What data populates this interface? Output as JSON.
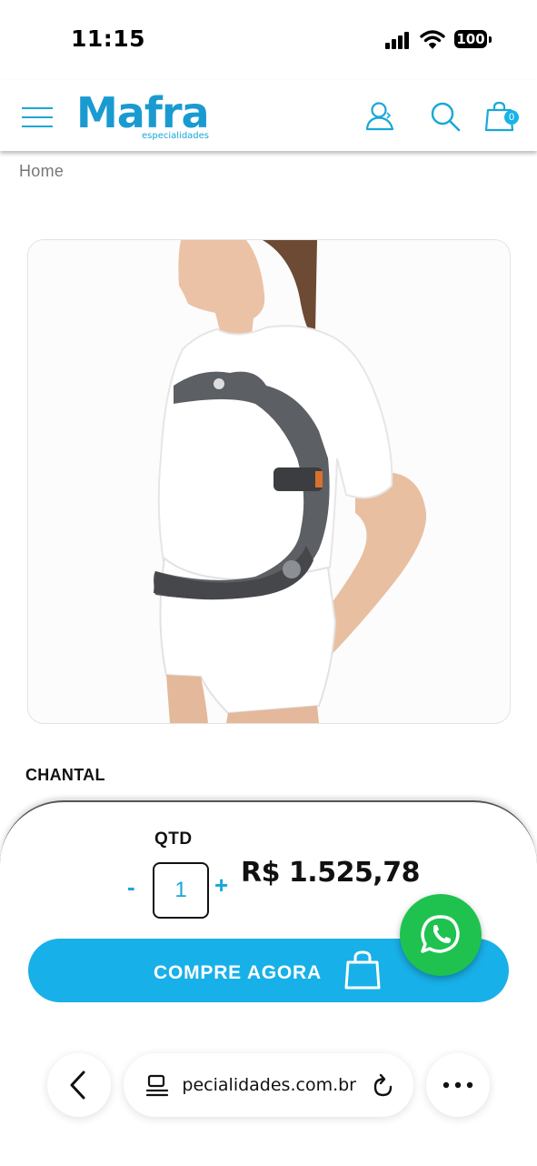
{
  "status_bar": {
    "time": "11:15",
    "battery": "100"
  },
  "header": {
    "logo_text": "Mafra",
    "logo_subtext": "especialidades",
    "cart_count": "0",
    "accent_color": "#1aa7d8"
  },
  "breadcrumb": {
    "home": "Home"
  },
  "product": {
    "name": "CHANTAL",
    "image": "woman-wearing-grey-hip-orthosis"
  },
  "purchase": {
    "qty_label": "QTD",
    "minus": "-",
    "plus": "+",
    "quantity": "1",
    "price": "R$ 1.525,78",
    "buy_label": "COMPRE AGORA",
    "button_color": "#18b0e8"
  },
  "whatsapp": {
    "icon": "whatsapp-icon",
    "color": "#1fc24f"
  },
  "browser": {
    "url": "especialidades.com.br"
  }
}
